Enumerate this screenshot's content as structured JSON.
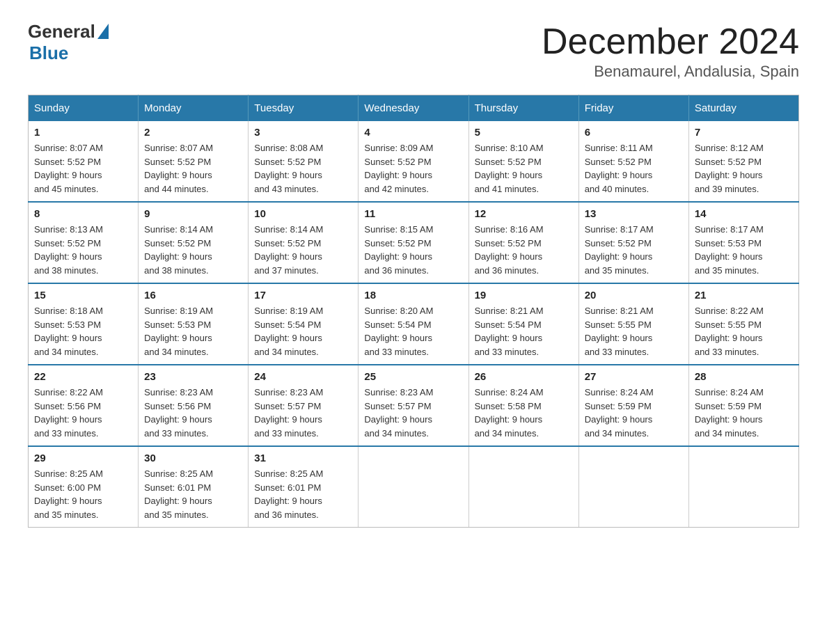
{
  "header": {
    "logo": {
      "general": "General",
      "blue": "Blue",
      "triangle": "▲"
    },
    "title": "December 2024",
    "subtitle": "Benamaurel, Andalusia, Spain"
  },
  "calendar": {
    "headers": [
      "Sunday",
      "Monday",
      "Tuesday",
      "Wednesday",
      "Thursday",
      "Friday",
      "Saturday"
    ],
    "weeks": [
      [
        {
          "day": "1",
          "sunrise": "8:07 AM",
          "sunset": "5:52 PM",
          "daylight": "9 hours and 45 minutes."
        },
        {
          "day": "2",
          "sunrise": "8:07 AM",
          "sunset": "5:52 PM",
          "daylight": "9 hours and 44 minutes."
        },
        {
          "day": "3",
          "sunrise": "8:08 AM",
          "sunset": "5:52 PM",
          "daylight": "9 hours and 43 minutes."
        },
        {
          "day": "4",
          "sunrise": "8:09 AM",
          "sunset": "5:52 PM",
          "daylight": "9 hours and 42 minutes."
        },
        {
          "day": "5",
          "sunrise": "8:10 AM",
          "sunset": "5:52 PM",
          "daylight": "9 hours and 41 minutes."
        },
        {
          "day": "6",
          "sunrise": "8:11 AM",
          "sunset": "5:52 PM",
          "daylight": "9 hours and 40 minutes."
        },
        {
          "day": "7",
          "sunrise": "8:12 AM",
          "sunset": "5:52 PM",
          "daylight": "9 hours and 39 minutes."
        }
      ],
      [
        {
          "day": "8",
          "sunrise": "8:13 AM",
          "sunset": "5:52 PM",
          "daylight": "9 hours and 38 minutes."
        },
        {
          "day": "9",
          "sunrise": "8:14 AM",
          "sunset": "5:52 PM",
          "daylight": "9 hours and 38 minutes."
        },
        {
          "day": "10",
          "sunrise": "8:14 AM",
          "sunset": "5:52 PM",
          "daylight": "9 hours and 37 minutes."
        },
        {
          "day": "11",
          "sunrise": "8:15 AM",
          "sunset": "5:52 PM",
          "daylight": "9 hours and 36 minutes."
        },
        {
          "day": "12",
          "sunrise": "8:16 AM",
          "sunset": "5:52 PM",
          "daylight": "9 hours and 36 minutes."
        },
        {
          "day": "13",
          "sunrise": "8:17 AM",
          "sunset": "5:52 PM",
          "daylight": "9 hours and 35 minutes."
        },
        {
          "day": "14",
          "sunrise": "8:17 AM",
          "sunset": "5:53 PM",
          "daylight": "9 hours and 35 minutes."
        }
      ],
      [
        {
          "day": "15",
          "sunrise": "8:18 AM",
          "sunset": "5:53 PM",
          "daylight": "9 hours and 34 minutes."
        },
        {
          "day": "16",
          "sunrise": "8:19 AM",
          "sunset": "5:53 PM",
          "daylight": "9 hours and 34 minutes."
        },
        {
          "day": "17",
          "sunrise": "8:19 AM",
          "sunset": "5:54 PM",
          "daylight": "9 hours and 34 minutes."
        },
        {
          "day": "18",
          "sunrise": "8:20 AM",
          "sunset": "5:54 PM",
          "daylight": "9 hours and 33 minutes."
        },
        {
          "day": "19",
          "sunrise": "8:21 AM",
          "sunset": "5:54 PM",
          "daylight": "9 hours and 33 minutes."
        },
        {
          "day": "20",
          "sunrise": "8:21 AM",
          "sunset": "5:55 PM",
          "daylight": "9 hours and 33 minutes."
        },
        {
          "day": "21",
          "sunrise": "8:22 AM",
          "sunset": "5:55 PM",
          "daylight": "9 hours and 33 minutes."
        }
      ],
      [
        {
          "day": "22",
          "sunrise": "8:22 AM",
          "sunset": "5:56 PM",
          "daylight": "9 hours and 33 minutes."
        },
        {
          "day": "23",
          "sunrise": "8:23 AM",
          "sunset": "5:56 PM",
          "daylight": "9 hours and 33 minutes."
        },
        {
          "day": "24",
          "sunrise": "8:23 AM",
          "sunset": "5:57 PM",
          "daylight": "9 hours and 33 minutes."
        },
        {
          "day": "25",
          "sunrise": "8:23 AM",
          "sunset": "5:57 PM",
          "daylight": "9 hours and 34 minutes."
        },
        {
          "day": "26",
          "sunrise": "8:24 AM",
          "sunset": "5:58 PM",
          "daylight": "9 hours and 34 minutes."
        },
        {
          "day": "27",
          "sunrise": "8:24 AM",
          "sunset": "5:59 PM",
          "daylight": "9 hours and 34 minutes."
        },
        {
          "day": "28",
          "sunrise": "8:24 AM",
          "sunset": "5:59 PM",
          "daylight": "9 hours and 34 minutes."
        }
      ],
      [
        {
          "day": "29",
          "sunrise": "8:25 AM",
          "sunset": "6:00 PM",
          "daylight": "9 hours and 35 minutes."
        },
        {
          "day": "30",
          "sunrise": "8:25 AM",
          "sunset": "6:01 PM",
          "daylight": "9 hours and 35 minutes."
        },
        {
          "day": "31",
          "sunrise": "8:25 AM",
          "sunset": "6:01 PM",
          "daylight": "9 hours and 36 minutes."
        },
        null,
        null,
        null,
        null
      ]
    ],
    "labels": {
      "sunrise": "Sunrise:",
      "sunset": "Sunset:",
      "daylight": "Daylight:"
    }
  }
}
